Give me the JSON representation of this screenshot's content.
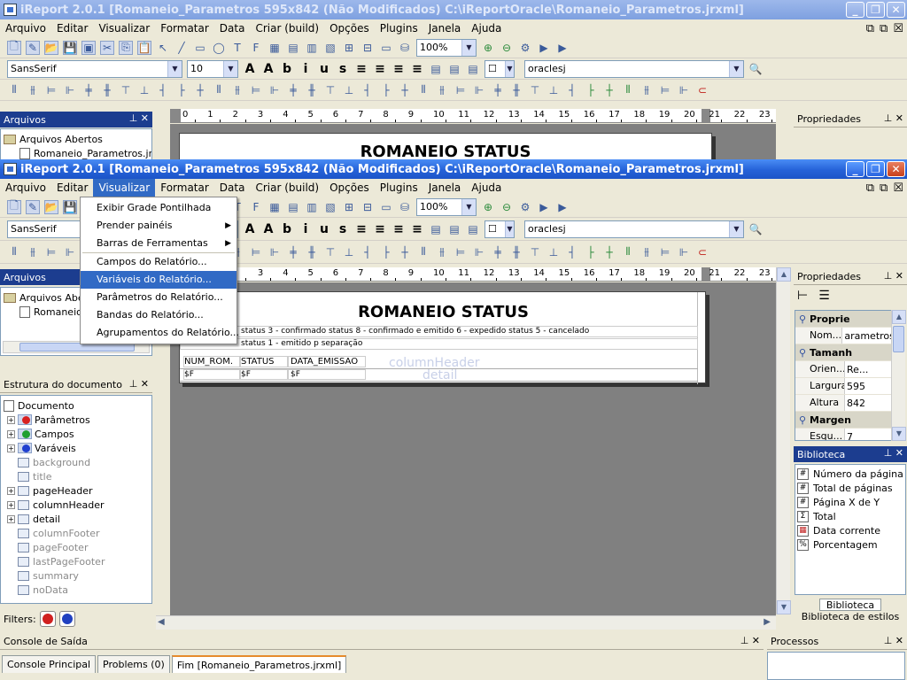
{
  "window_bg": {
    "title": "iReport 2.0.1  [Romaneio_Parametros 595x842 (Não Modificados) C:\\iReportOracle\\Romaneio_Parametros.jrxml]",
    "arquivos_title": "Arquivos",
    "arquivos_items": [
      "Arquivos Abertos",
      "Romaneio_Parametros.jrxml"
    ],
    "propriedades_title": "Propriedades",
    "report_title": "ROMANEIO STATUS"
  },
  "window": {
    "title": "iReport 2.0.1  [Romaneio_Parametros 595x842 (Não Modificados) C:\\iReportOracle\\Romaneio_Parametros.jrxml]",
    "min_icon": "minimize-icon",
    "max_icon": "maximize-icon",
    "close_icon": "close-icon"
  },
  "menubar": [
    "Arquivo",
    "Editar",
    "Visualizar",
    "Formatar",
    "Data",
    "Criar (build)",
    "Opções",
    "Plugins",
    "Janela",
    "Ajuda"
  ],
  "toolbar": {
    "zoom": "100%",
    "font": "SansSerif",
    "font_size": "10",
    "connection": "oraclesj"
  },
  "visualizar_menu": {
    "items": [
      {
        "label": "Exibir Grade Pontilhada",
        "submenu": false
      },
      {
        "label": "Prender painéis",
        "submenu": true
      },
      {
        "label": "Barras de Ferramentas",
        "submenu": true
      },
      {
        "label": "Campos do Relatório...",
        "submenu": false
      },
      {
        "label": "Variáveis do Relatório...",
        "submenu": false,
        "highlighted": true
      },
      {
        "label": "Parâmetros do Relatório...",
        "submenu": false
      },
      {
        "label": "Bandas do Relatório...",
        "submenu": false
      },
      {
        "label": "Agrupamentos do Relatório...",
        "submenu": false
      }
    ]
  },
  "arquivos": {
    "title": "Arquivos",
    "items": [
      "Arquivos Abertos",
      "Romaneio_Parametros.jrxml"
    ]
  },
  "estrutura": {
    "title": "Estrutura do documento",
    "root": "Documento",
    "nodes": [
      {
        "label": "Parâmetros",
        "expandable": true,
        "dim": false,
        "icon": "red-dot-icon"
      },
      {
        "label": "Campos",
        "expandable": true,
        "dim": false,
        "icon": "green-dot-icon"
      },
      {
        "label": "Varáveis",
        "expandable": true,
        "dim": false,
        "icon": "blue-dot-icon"
      },
      {
        "label": "background",
        "expandable": false,
        "dim": true,
        "icon": "band-icon"
      },
      {
        "label": "title",
        "expandable": false,
        "dim": true,
        "icon": "band-icon"
      },
      {
        "label": "pageHeader",
        "expandable": true,
        "dim": false,
        "icon": "band-icon"
      },
      {
        "label": "columnHeader",
        "expandable": true,
        "dim": false,
        "icon": "band-icon"
      },
      {
        "label": "detail",
        "expandable": true,
        "dim": false,
        "icon": "band-icon"
      },
      {
        "label": "columnFooter",
        "expandable": false,
        "dim": true,
        "icon": "band-icon"
      },
      {
        "label": "pageFooter",
        "expandable": false,
        "dim": true,
        "icon": "band-icon"
      },
      {
        "label": "lastPageFooter",
        "expandable": false,
        "dim": true,
        "icon": "band-icon"
      },
      {
        "label": "summary",
        "expandable": false,
        "dim": true,
        "icon": "band-icon"
      },
      {
        "label": "noData",
        "expandable": false,
        "dim": true,
        "icon": "band-icon"
      }
    ],
    "filters_label": "Filters:"
  },
  "ruler": [
    "0",
    "1",
    "2",
    "3",
    "4",
    "5",
    "6",
    "7",
    "8",
    "9",
    "10",
    "11",
    "12",
    "13",
    "14",
    "15",
    "16",
    "17",
    "18",
    "19",
    "20",
    "21",
    "22",
    "23"
  ],
  "report": {
    "title": "ROMANEIO STATUS",
    "line1": "status 3 - confirmado    status 8 - confirmado e emitido    6 - expedido status 5 - cancelado",
    "line2": "status 1 - emitido p separação",
    "col_headers": [
      "NUM_ROM.",
      "STATUS",
      "DATA_EMISSAO"
    ],
    "fields": [
      "$F",
      "$F",
      "$F"
    ],
    "band_column_header": "columnHeader",
    "band_detail": "detail"
  },
  "propriedades": {
    "title": "Propriedades",
    "sections": [
      {
        "header": "Proprie",
        "rows": [
          {
            "k": "Nom...",
            "v": "arametros"
          }
        ]
      },
      {
        "header": "Tamanh",
        "rows": [
          {
            "k": "Orien...",
            "v": "Re..."
          },
          {
            "k": "Largura",
            "v": "595"
          },
          {
            "k": "Altura",
            "v": "842"
          }
        ]
      },
      {
        "header": "Margen",
        "rows": [
          {
            "k": "Esqu...",
            "v": "7"
          }
        ]
      }
    ]
  },
  "biblioteca": {
    "title": "Biblioteca",
    "items": [
      {
        "label": "Número da página",
        "icon": "hash-icon"
      },
      {
        "label": "Total de páginas",
        "icon": "hash-icon"
      },
      {
        "label": "Página X de Y",
        "icon": "hash-icon"
      },
      {
        "label": "Total",
        "icon": "sigma-icon"
      },
      {
        "label": "Data corrente",
        "icon": "calendar-icon"
      },
      {
        "label": "Porcentagem",
        "icon": "percent-icon"
      }
    ],
    "tabs": [
      "Biblioteca",
      "Biblioteca de estilos"
    ]
  },
  "console": {
    "title": "Console de Saída",
    "tabs": [
      "Console Principal",
      "Problems (0)",
      "Fim [Romaneio_Parametros.jrxml]"
    ]
  },
  "processos": {
    "title": "Processos"
  }
}
